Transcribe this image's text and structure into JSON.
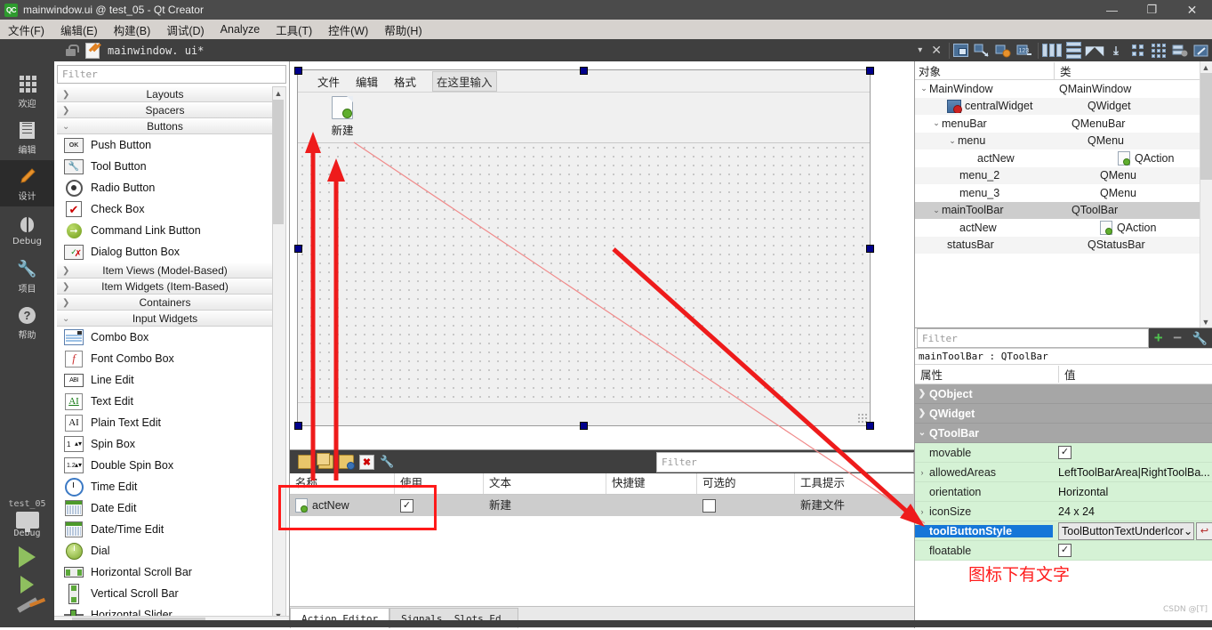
{
  "window": {
    "title": "mainwindow.ui @ test_05 - Qt Creator",
    "logo": "QC",
    "minimize": "—",
    "maximize": "❐",
    "close": "✕"
  },
  "menubar": {
    "items": [
      {
        "label": "文件(F)"
      },
      {
        "label": "编辑(E)"
      },
      {
        "label": "构建(B)"
      },
      {
        "label": "调试(D)"
      },
      {
        "label": "Analyze"
      },
      {
        "label": "工具(T)"
      },
      {
        "label": "控件(W)"
      },
      {
        "label": "帮助(H)"
      }
    ]
  },
  "modebar": {
    "items": [
      {
        "label": "欢迎",
        "icon": "grid-icon",
        "active": false
      },
      {
        "label": "编辑",
        "icon": "document-icon",
        "active": false
      },
      {
        "label": "设计",
        "icon": "pencil-icon",
        "active": true
      },
      {
        "label": "Debug",
        "icon": "bug-icon",
        "active": false
      },
      {
        "label": "项目",
        "icon": "wrench-icon",
        "active": false
      },
      {
        "label": "帮助",
        "icon": "question-icon",
        "active": false
      }
    ],
    "kit": {
      "project": "test_05",
      "build_config": "Debug"
    }
  },
  "editor_tab": {
    "filename": "mainwindow. ui*",
    "lock_icon": "unlock-icon",
    "chevron": "▾",
    "close": "✕"
  },
  "widgetbox": {
    "filter_placeholder": "Filter",
    "groups": [
      {
        "name": "Layouts",
        "expanded": false,
        "items": []
      },
      {
        "name": "Spacers",
        "expanded": false,
        "items": []
      },
      {
        "name": "Buttons",
        "expanded": true,
        "items": [
          {
            "label": "Push Button",
            "icon": "push-button-icon"
          },
          {
            "label": "Tool Button",
            "icon": "tool-button-icon"
          },
          {
            "label": "Radio Button",
            "icon": "radio-button-icon"
          },
          {
            "label": "Check Box",
            "icon": "check-box-icon"
          },
          {
            "label": "Command Link Button",
            "icon": "command-link-icon"
          },
          {
            "label": "Dialog Button Box",
            "icon": "dialog-button-box-icon"
          }
        ]
      },
      {
        "name": "Item Views (Model-Based)",
        "expanded": false,
        "items": []
      },
      {
        "name": "Item Widgets (Item-Based)",
        "expanded": false,
        "items": []
      },
      {
        "name": "Containers",
        "expanded": false,
        "items": []
      },
      {
        "name": "Input Widgets",
        "expanded": true,
        "items": [
          {
            "label": "Combo Box",
            "icon": "combo-box-icon"
          },
          {
            "label": "Font Combo Box",
            "icon": "font-combo-box-icon"
          },
          {
            "label": "Line Edit",
            "icon": "line-edit-icon"
          },
          {
            "label": "Text Edit",
            "icon": "text-edit-icon"
          },
          {
            "label": "Plain Text Edit",
            "icon": "plain-text-edit-icon"
          },
          {
            "label": "Spin Box",
            "icon": "spin-box-icon"
          },
          {
            "label": "Double Spin Box",
            "icon": "double-spin-box-icon"
          },
          {
            "label": "Time Edit",
            "icon": "time-edit-icon"
          },
          {
            "label": "Date Edit",
            "icon": "date-edit-icon"
          },
          {
            "label": "Date/Time Edit",
            "icon": "date-time-edit-icon"
          },
          {
            "label": "Dial",
            "icon": "dial-icon"
          },
          {
            "label": "Horizontal Scroll Bar",
            "icon": "horizontal-scroll-bar-icon"
          },
          {
            "label": "Vertical Scroll Bar",
            "icon": "vertical-scroll-bar-icon"
          },
          {
            "label": "Horizontal Slider",
            "icon": "horizontal-slider-icon"
          }
        ]
      }
    ]
  },
  "form": {
    "menus": [
      "文件",
      "编辑",
      "格式"
    ],
    "menu_placeholder": "在这里输入",
    "toolbar_button": {
      "label": "新建",
      "icon": "new-file-icon"
    }
  },
  "object_tree": {
    "col_object": "对象",
    "col_class": "类",
    "rows": [
      {
        "name": "MainWindow",
        "class": "QMainWindow",
        "indent": 0,
        "twisty": "⌄",
        "icon": "",
        "selected": false
      },
      {
        "name": "centralWidget",
        "class": "QWidget",
        "indent": 2,
        "twisty": "",
        "icon": "central-widget-icon",
        "selected": false
      },
      {
        "name": "menuBar",
        "class": "QMenuBar",
        "indent": 1,
        "twisty": "⌄",
        "icon": "",
        "selected": false
      },
      {
        "name": "menu",
        "class": "QMenu",
        "indent": 2,
        "twisty": "⌄",
        "icon": "",
        "selected": false
      },
      {
        "name": "actNew",
        "class": "QAction",
        "indent": 4,
        "twisty": "",
        "icon": "action-icon",
        "selected": false
      },
      {
        "name": "menu_2",
        "class": "QMenu",
        "indent": 3,
        "twisty": "",
        "icon": "",
        "selected": false
      },
      {
        "name": "menu_3",
        "class": "QMenu",
        "indent": 3,
        "twisty": "",
        "icon": "",
        "selected": false
      },
      {
        "name": "mainToolBar",
        "class": "QToolBar",
        "indent": 1,
        "twisty": "⌄",
        "icon": "",
        "selected": true
      },
      {
        "name": "actNew",
        "class": "QAction",
        "indent": 3,
        "twisty": "",
        "icon": "action-icon",
        "selected": false
      },
      {
        "name": "statusBar",
        "class": "QStatusBar",
        "indent": 2,
        "twisty": "",
        "icon": "",
        "selected": false
      }
    ]
  },
  "property_editor": {
    "filter_placeholder": "Filter",
    "add_button": "+",
    "remove_button": "−",
    "config_button": "wrench-icon",
    "object_line": "mainToolBar : QToolBar",
    "col_property": "属性",
    "col_value": "值",
    "groups": [
      {
        "name": "QObject",
        "expanded": false
      },
      {
        "name": "QWidget",
        "expanded": false
      },
      {
        "name": "QToolBar",
        "expanded": true
      }
    ],
    "rows": [
      {
        "key": "movable",
        "value": "",
        "type": "checkbox",
        "checked": true,
        "twisty": "",
        "highlight": false
      },
      {
        "key": "allowedAreas",
        "value": "LeftToolBarArea|RightToolBa...",
        "type": "text",
        "twisty": "›",
        "highlight": false
      },
      {
        "key": "orientation",
        "value": "Horizontal",
        "type": "text",
        "twisty": "",
        "highlight": false
      },
      {
        "key": "iconSize",
        "value": "24 x 24",
        "type": "text",
        "twisty": "›",
        "highlight": false
      },
      {
        "key": "toolButtonStyle",
        "value": "ToolButtonTextUnderIcor",
        "type": "combo",
        "twisty": "",
        "highlight": true
      },
      {
        "key": "floatable",
        "value": "",
        "type": "checkbox",
        "checked": true,
        "twisty": "",
        "highlight": false
      }
    ],
    "annotation": "图标下有文字",
    "watermark": "CSDN @[T]"
  },
  "action_editor": {
    "filter_placeholder": "Filter",
    "toolbar_icons": [
      "new-action-icon",
      "copy-action-icon",
      "paste-action-icon",
      "delete-action-icon",
      "configure-icon"
    ],
    "columns": [
      "名称",
      "使用",
      "文本",
      "快捷键",
      "可选的",
      "工具提示"
    ],
    "rows": [
      {
        "name": "actNew",
        "used": true,
        "text": "新建",
        "shortcut": "",
        "checkable": false,
        "tooltip": "新建文件"
      }
    ],
    "tabs": [
      {
        "label": "Action Editor",
        "active": true
      },
      {
        "label": "Signals _Slots Ed…",
        "active": false
      }
    ]
  }
}
